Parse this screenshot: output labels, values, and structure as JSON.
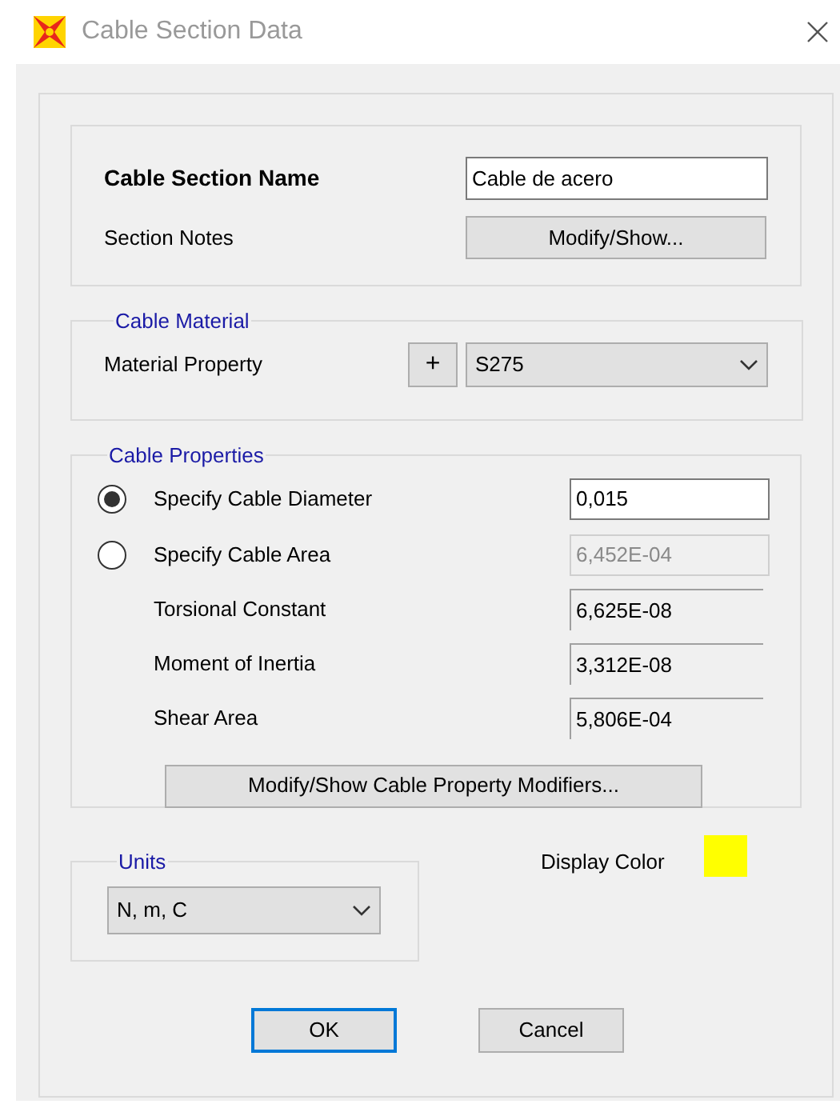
{
  "window": {
    "title": "Cable Section Data"
  },
  "section": {
    "name_label": "Cable Section Name",
    "name_value": "Cable de acero",
    "notes_label": "Section Notes",
    "notes_button": "Modify/Show..."
  },
  "material": {
    "title": "Cable Material",
    "label": "Material Property",
    "add_button": "+",
    "value": "S275"
  },
  "properties": {
    "title": "Cable Properties",
    "options": [
      {
        "label": "Specify Cable Diameter",
        "selected": true,
        "value": "0,015"
      },
      {
        "label": "Specify Cable Area",
        "selected": false,
        "value": "6,452E-04"
      }
    ],
    "fields": [
      {
        "label": "Torsional Constant",
        "value": "6,625E-08"
      },
      {
        "label": "Moment of Inertia",
        "value": "3,312E-08"
      },
      {
        "label": "Shear Area",
        "value": "5,806E-04"
      }
    ],
    "button": "Modify/Show Cable Property Modifiers..."
  },
  "units": {
    "title": "Units",
    "value": "N, m, C"
  },
  "display_color": {
    "label": "Display Color",
    "color": "#ffff00"
  },
  "buttons": [
    {
      "label": "OK",
      "default": true
    },
    {
      "label": "Cancel",
      "default": false
    }
  ]
}
